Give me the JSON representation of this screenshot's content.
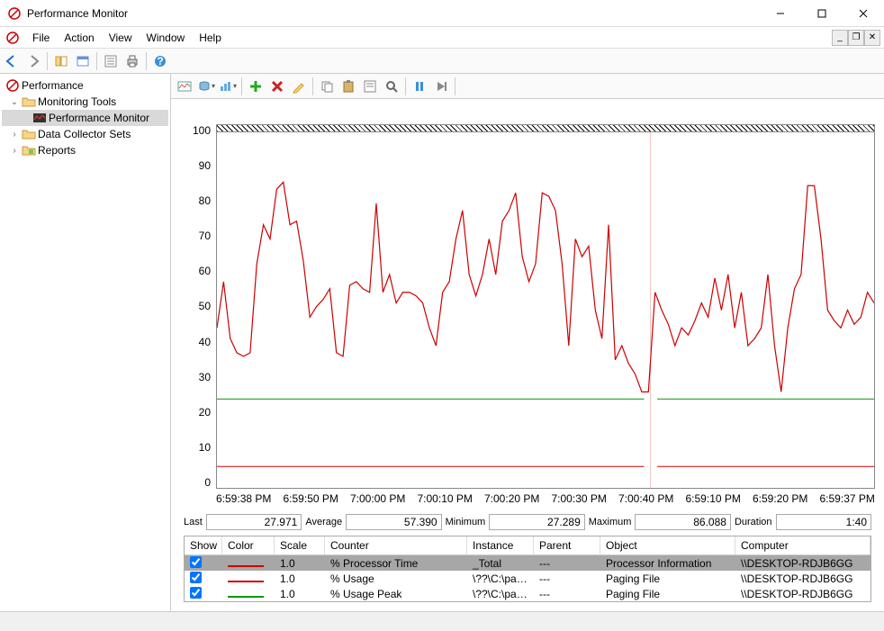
{
  "window": {
    "title": "Performance Monitor"
  },
  "menu": {
    "file": "File",
    "action": "Action",
    "view": "View",
    "window": "Window",
    "help": "Help"
  },
  "tree": {
    "root": "Performance",
    "monitoring": "Monitoring Tools",
    "perfmon": "Performance Monitor",
    "dcs": "Data Collector Sets",
    "reports": "Reports"
  },
  "xaxis": {
    "t0": "6:59:38 PM",
    "t1": "6:59:50 PM",
    "t2": "7:00:00 PM",
    "t3": "7:00:10 PM",
    "t4": "7:00:20 PM",
    "t5": "7:00:30 PM",
    "t6": "7:00:40 PM",
    "t7": "6:59:10 PM",
    "t8": "6:59:20 PM",
    "t9": "6:59:37 PM"
  },
  "yaxis": {
    "y100": "100",
    "y90": "90",
    "y80": "80",
    "y70": "70",
    "y60": "60",
    "y50": "50",
    "y40": "40",
    "y30": "30",
    "y20": "20",
    "y10": "10",
    "y0": "0"
  },
  "stats": {
    "last_lbl": "Last",
    "last": "27.971",
    "avg_lbl": "Average",
    "avg": "57.390",
    "min_lbl": "Minimum",
    "min": "27.289",
    "max_lbl": "Maximum",
    "max": "86.088",
    "dur_lbl": "Duration",
    "dur": "1:40"
  },
  "counters": {
    "hdr": {
      "show": "Show",
      "color": "Color",
      "scale": "Scale",
      "counter": "Counter",
      "instance": "Instance",
      "parent": "Parent",
      "object": "Object",
      "computer": "Computer"
    },
    "rows": [
      {
        "scale": "1.0",
        "counter": "% Processor Time",
        "instance": "_Total",
        "parent": "---",
        "object": "Processor Information",
        "computer": "\\\\DESKTOP-RDJB6GG",
        "color": "#cc0000"
      },
      {
        "scale": "1.0",
        "counter": "% Usage",
        "instance": "\\??\\C:\\pag...",
        "parent": "---",
        "object": "Paging File",
        "computer": "\\\\DESKTOP-RDJB6GG",
        "color": "#cc0000"
      },
      {
        "scale": "1.0",
        "counter": "% Usage Peak",
        "instance": "\\??\\C:\\pag...",
        "parent": "---",
        "object": "Paging File",
        "computer": "\\\\DESKTOP-RDJB6GG",
        "color": "#009900"
      }
    ]
  },
  "chart_data": {
    "type": "line",
    "ylim": [
      0,
      100
    ],
    "cursor_x": 66,
    "x_time_labels": [
      "6:59:38 PM",
      "6:59:50 PM",
      "7:00:00 PM",
      "7:00:10 PM",
      "7:00:20 PM",
      "7:00:30 PM",
      "7:00:40 PM",
      "6:59:10 PM",
      "6:59:20 PM",
      "6:59:37 PM"
    ],
    "series": [
      {
        "name": "% Processor Time",
        "color": "#cc0000",
        "values": [
          45,
          58,
          42,
          38,
          37,
          38,
          63,
          74,
          70,
          84,
          86,
          74,
          75,
          64,
          48,
          51,
          53,
          56,
          38,
          37,
          57,
          58,
          56,
          55,
          80,
          55,
          60,
          52,
          55,
          55,
          54,
          52,
          45,
          40,
          55,
          58,
          70,
          78,
          60,
          54,
          60,
          70,
          60,
          75,
          78,
          83,
          65,
          58,
          63,
          83,
          82,
          78,
          63,
          40,
          70,
          65,
          68,
          50,
          42,
          74,
          36,
          40,
          35,
          32,
          27,
          27,
          55,
          50,
          46,
          40,
          45,
          43,
          47,
          52,
          48,
          59,
          50,
          60,
          45,
          55,
          40,
          42,
          45,
          60,
          40,
          27,
          45,
          56,
          60,
          85,
          85,
          70,
          50,
          47,
          45,
          50,
          46,
          48,
          55,
          52
        ]
      },
      {
        "name": "% Usage",
        "color": "#cc0000",
        "values_const": 6,
        "gap_at": 66
      },
      {
        "name": "% Usage Peak",
        "color": "#009900",
        "values_const": 25,
        "gap_at": 66
      }
    ]
  }
}
